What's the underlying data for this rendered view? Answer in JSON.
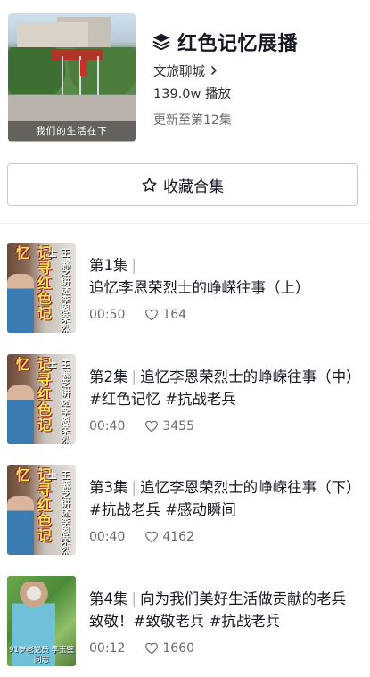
{
  "collection": {
    "title": "红色记忆展播",
    "author": "文旅聊城",
    "plays": "139.0w 播放",
    "updated": "更新至第12集",
    "cover_caption": "我们的生活在下",
    "collect_label": "收藏合集"
  },
  "thumbs": {
    "red_big_text": "记寻红色记忆",
    "red_small_text": "王毓芝讲述李恩荣烈士"
  },
  "episodes": [
    {
      "ep_label": "第1集",
      "title_line": "追忆李恩荣烈士的峥嵘往事（上）",
      "duration": "00:50",
      "likes": "164",
      "thumb_style": "red"
    },
    {
      "ep_label": "第2集",
      "title_line": "追忆李恩荣烈士的峥嵘往事（中）#红色记忆 #抗战老兵",
      "duration": "00:40",
      "likes": "3455",
      "thumb_style": "red"
    },
    {
      "ep_label": "第3集",
      "title_line": "追忆李恩荣烈士的峥嵘往事（下）#抗战老兵 #感动瞬间",
      "duration": "00:40",
      "likes": "4162",
      "thumb_style": "red"
    },
    {
      "ep_label": "第4集",
      "title_line": "向为我们美好生活做贡献的老兵致敬！#致敬老兵 #抗战老兵",
      "duration": "00:12",
      "likes": "1660",
      "thumb_style": "green",
      "thumb_caption": "91岁老党员 李玉璧同志"
    }
  ],
  "icons": {
    "layers": "layers-icon",
    "chevron": "chevron-right-icon",
    "star": "star-outline-icon",
    "heart": "heart-outline-icon"
  }
}
